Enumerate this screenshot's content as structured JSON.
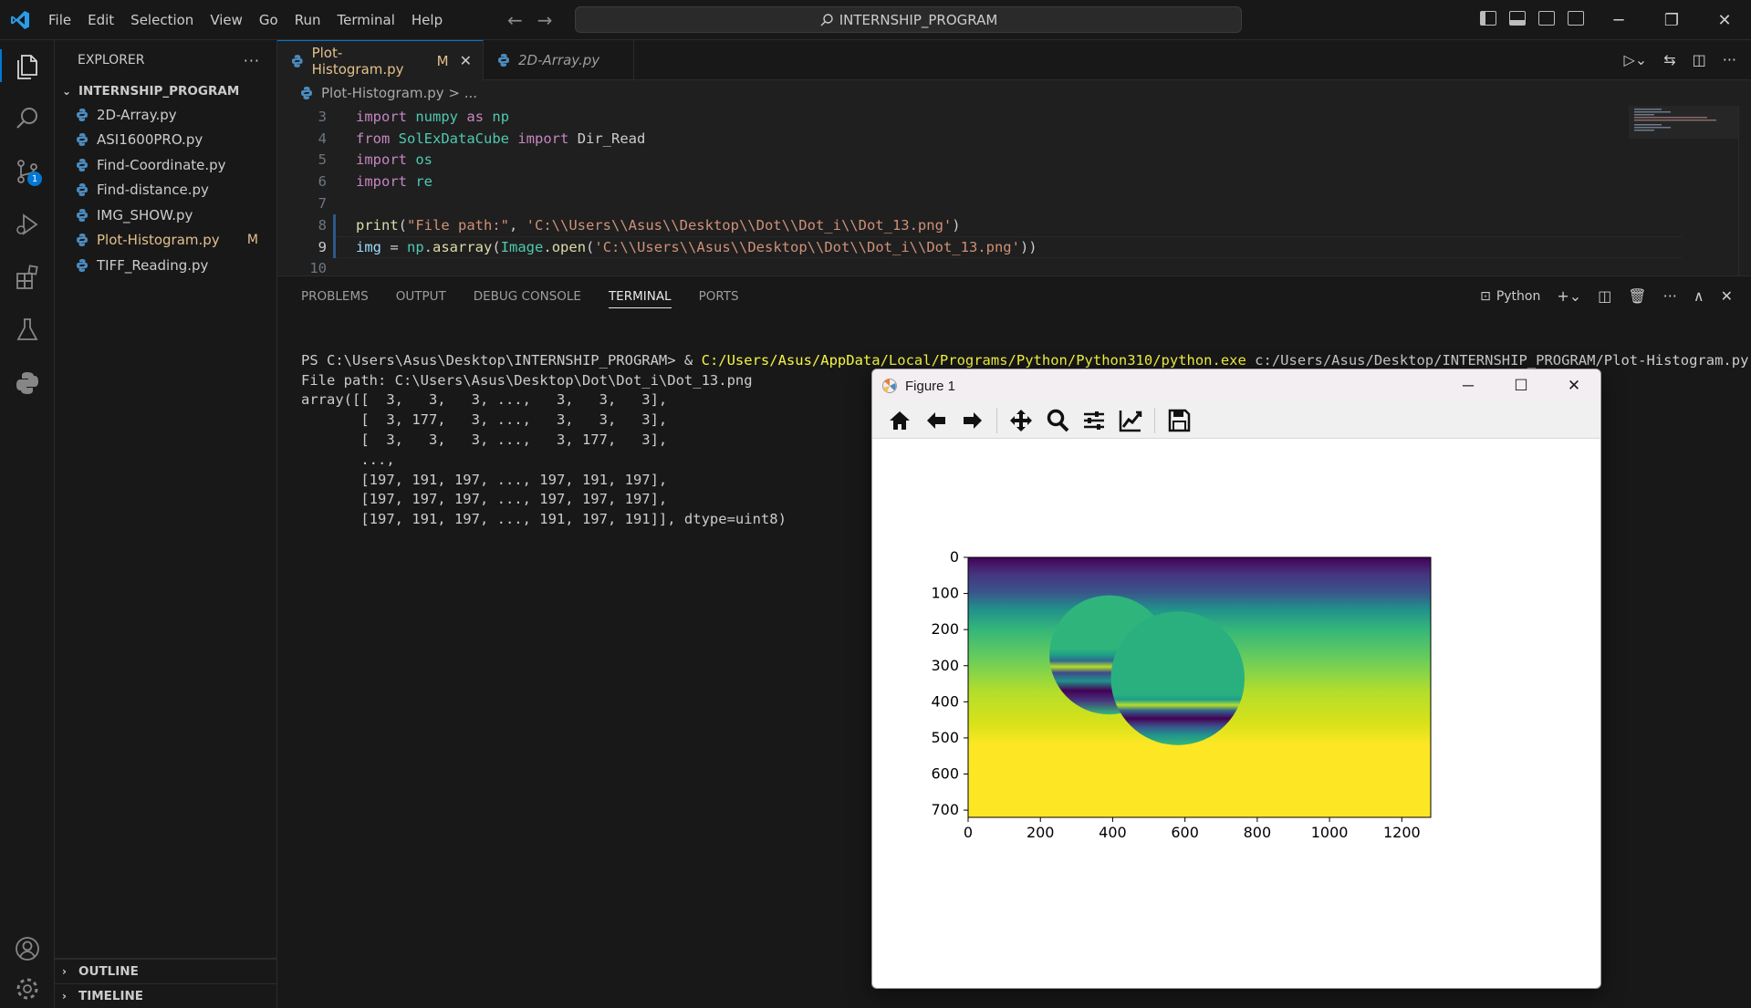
{
  "menu": [
    "File",
    "Edit",
    "Selection",
    "View",
    "Go",
    "Run",
    "Terminal",
    "Help"
  ],
  "command_center": "INTERNSHIP_PROGRAM",
  "activity": {
    "scm_badge": "1"
  },
  "explorer": {
    "title": "EXPLORER",
    "more": "···",
    "folder": "INTERNSHIP_PROGRAM",
    "files": [
      {
        "name": "2D-Array.py",
        "status": ""
      },
      {
        "name": "ASI1600PRO.py",
        "status": ""
      },
      {
        "name": "Find-Coordinate.py",
        "status": ""
      },
      {
        "name": "Find-distance.py",
        "status": ""
      },
      {
        "name": "IMG_SHOW.py",
        "status": ""
      },
      {
        "name": "Plot-Histogram.py",
        "status": "M"
      },
      {
        "name": "TIFF_Reading.py",
        "status": ""
      }
    ],
    "outline": "OUTLINE",
    "timeline": "TIMELINE"
  },
  "tabs": [
    {
      "name": "Plot-Histogram.py",
      "status": "M"
    },
    {
      "name": "2D-Array.py",
      "status": ""
    }
  ],
  "breadcrumb": "Plot-Histogram.py > ...",
  "code": {
    "line_numbers": [
      "3",
      "4",
      "5",
      "6",
      "7",
      "8",
      "9",
      "10"
    ],
    "line3": {
      "kw": "import",
      "mod": "numpy",
      "as": "as",
      "alias": "np"
    },
    "line4": {
      "kw": "from",
      "mod": "SolExDataCube",
      "kw2": "import",
      "name": "Dir_Read"
    },
    "line5": {
      "kw": "import",
      "mod": "os"
    },
    "line6": {
      "kw": "import",
      "mod": "re"
    },
    "line8": {
      "fn": "print",
      "open": "(",
      "s1": "\"File path:\"",
      "comma": ", ",
      "s2": "'C:\\\\Users\\\\Asus\\\\Desktop\\\\Dot\\\\Dot_i\\\\Dot_13.png'",
      "close": ")"
    },
    "line9": {
      "var": "img",
      "eq": " = ",
      "np": "np",
      "dot1": ".",
      "fn1": "asarray",
      "p1": "(",
      "cls": "Image",
      "dot2": ".",
      "fn2": "open",
      "p2": "(",
      "s": "'C:\\\\Users\\\\Asus\\\\Desktop\\\\Dot\\\\Dot_i\\\\Dot_13.png'",
      "close": "))"
    }
  },
  "panel": {
    "tabs": [
      "PROBLEMS",
      "OUTPUT",
      "DEBUG CONSOLE",
      "TERMINAL",
      "PORTS"
    ],
    "active_tab": "TERMINAL",
    "terminal_name": "Python"
  },
  "terminal": {
    "prompt": "PS C:\\Users\\Asus\\Desktop\\INTERNSHIP_PROGRAM> & ",
    "exe": "C:/Users/Asus/AppData/Local/Programs/Python/Python310/python.exe",
    "script": " c:/Users/Asus/Desktop/INTERNSHIP_PROGRAM/Plot-Histogram.py",
    "output": [
      "File path: C:\\Users\\Asus\\Desktop\\Dot\\Dot_i\\Dot_13.png",
      "array([[  3,   3,   3, ...,   3,   3,   3],",
      "       [  3, 177,   3, ...,   3,   3,   3],",
      "       [  3,   3,   3, ...,   3, 177,   3],",
      "       ...,",
      "       [197, 191, 197, ..., 197, 191, 197],",
      "       [197, 197, 197, ..., 197, 197, 197],",
      "       [197, 191, 197, ..., 191, 197, 191]], dtype=uint8)"
    ]
  },
  "figure": {
    "title": "Figure 1",
    "toolbar": [
      "home-icon",
      "back-icon",
      "forward-icon",
      "pan-icon",
      "zoom-icon",
      "configure-subplots-icon",
      "edit-axis-icon",
      "save-icon"
    ]
  },
  "chart_data": {
    "type": "heatmap",
    "title": "",
    "xlabel": "",
    "ylabel": "",
    "xlim": [
      0,
      1280
    ],
    "ylim": [
      720,
      0
    ],
    "x_ticks": [
      "0",
      "200",
      "400",
      "600",
      "800",
      "1000",
      "1200"
    ],
    "y_ticks": [
      "0",
      "100",
      "200",
      "300",
      "400",
      "500",
      "600",
      "700"
    ],
    "colormap": "viridis",
    "image_width": 1280,
    "image_height": 720,
    "circles": [
      {
        "cx": 390,
        "cy": 270,
        "r": 165
      },
      {
        "cx": 580,
        "cy": 335,
        "r": 185
      }
    ]
  }
}
